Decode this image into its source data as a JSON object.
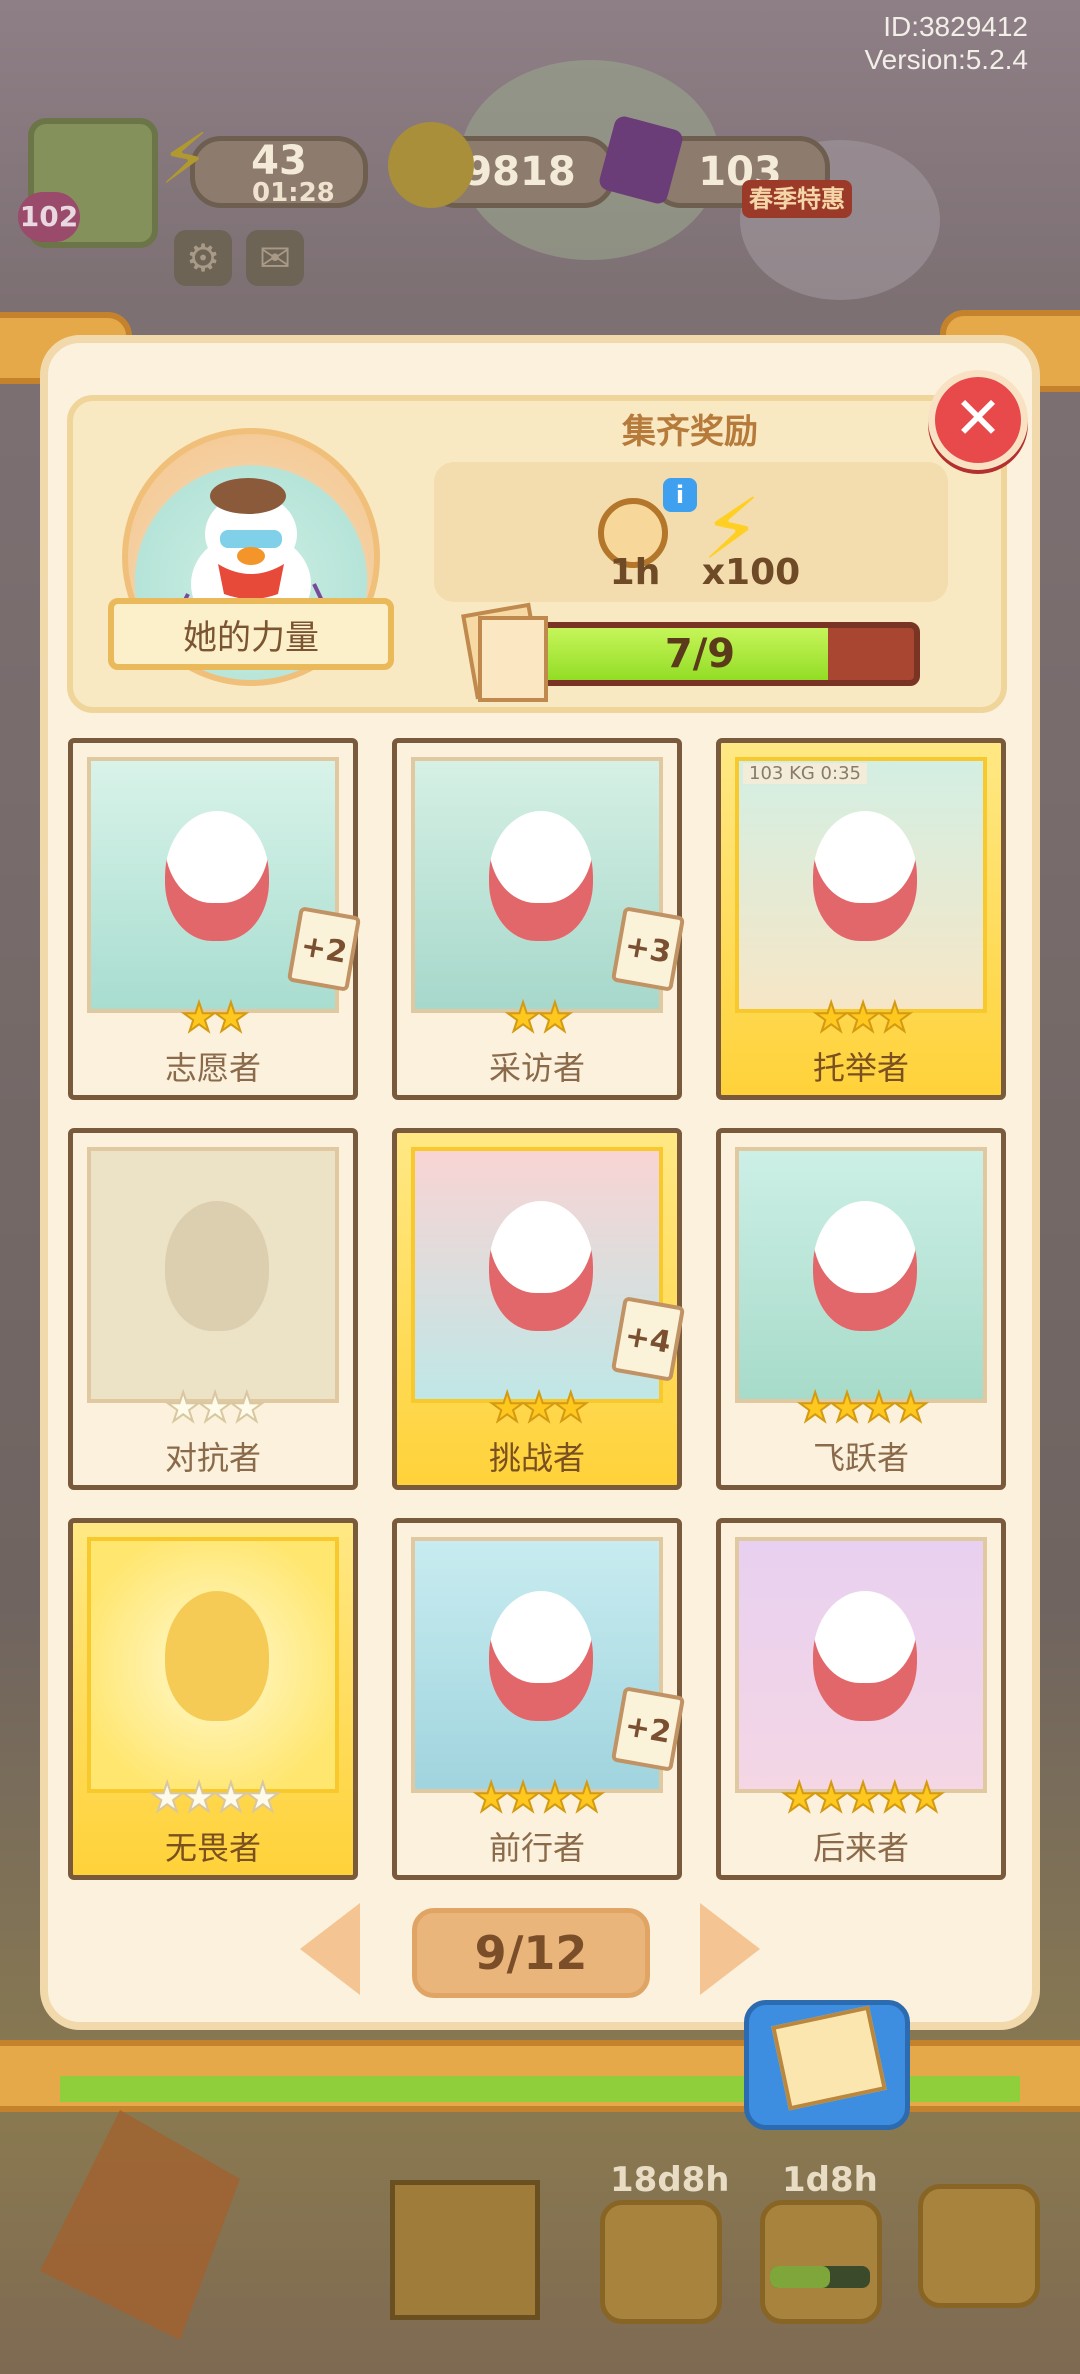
{
  "meta": {
    "id_label": "ID:3829412",
    "version_label": "Version:5.2.4"
  },
  "hud": {
    "level": "102",
    "energy": "43",
    "energy_timer": "01:28",
    "coins": "9818",
    "gems": "103",
    "promo_label": "春季特惠"
  },
  "reward": {
    "title": "集齐奖励",
    "time_reward": "1h",
    "energy_reward": "x100",
    "portrait_label": "她的力量",
    "progress_text": "7/9",
    "progress_fraction": 0.778
  },
  "cards": [
    {
      "name": "志愿者",
      "stars": 2,
      "max_stars": 2,
      "gold": false,
      "locked": false,
      "dup": "+2"
    },
    {
      "name": "采访者",
      "stars": 2,
      "max_stars": 2,
      "gold": false,
      "locked": false,
      "dup": "+3"
    },
    {
      "name": "托举者",
      "stars": 3,
      "max_stars": 3,
      "gold": true,
      "locked": false,
      "dup": "",
      "art_text": "103 KG 0:35"
    },
    {
      "name": "对抗者",
      "stars": 0,
      "max_stars": 3,
      "gold": false,
      "locked": true,
      "dup": ""
    },
    {
      "name": "挑战者",
      "stars": 3,
      "max_stars": 3,
      "gold": true,
      "locked": false,
      "dup": "+4"
    },
    {
      "name": "飞跃者",
      "stars": 4,
      "max_stars": 4,
      "gold": false,
      "locked": false,
      "dup": ""
    },
    {
      "name": "无畏者",
      "stars": 0,
      "max_stars": 4,
      "gold": true,
      "locked": true,
      "dup": ""
    },
    {
      "name": "前行者",
      "stars": 4,
      "max_stars": 4,
      "gold": false,
      "locked": false,
      "dup": "+2"
    },
    {
      "name": "后来者",
      "stars": 5,
      "max_stars": 5,
      "gold": false,
      "locked": false,
      "dup": ""
    }
  ],
  "pager": {
    "label": "9/12"
  },
  "bottom": {
    "timer_1": "18d8h",
    "timer_2": "1d8h"
  },
  "colors": {
    "accent": "#e8494a",
    "progress": "#9be12e",
    "panel": "#fbf1dc"
  }
}
